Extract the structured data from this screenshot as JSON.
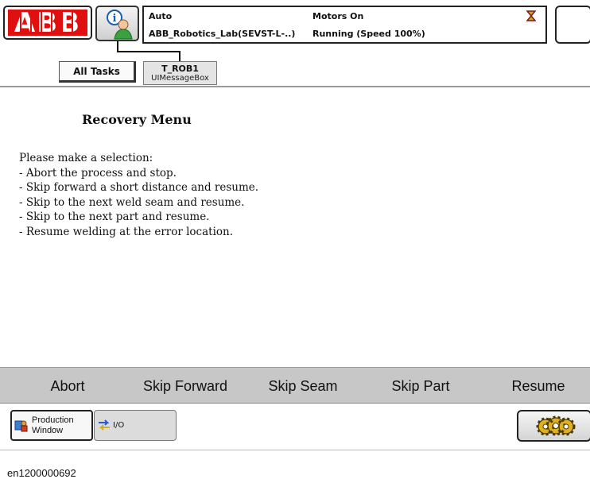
{
  "header": {
    "logo_text": "ABB",
    "mode": "Auto",
    "system_name": "ABB_Robotics_Lab(SEVST-L-..)",
    "motors_state": "Motors On",
    "run_state": "Running (Speed 100%)",
    "icons": [
      "info-user-icon",
      "hourglass-icon"
    ]
  },
  "tabs": {
    "all_tasks": "All Tasks",
    "task_name": "T_ROB1",
    "task_sub": "UIMessageBox"
  },
  "message": {
    "title": "Recovery Menu",
    "lines": [
      "Please make a selection:",
      "- Abort the process and stop.",
      "- Skip forward a short distance and resume.",
      "- Skip to the next weld seam and resume.",
      "- Skip to the next part and resume.",
      "- Resume welding at the error location."
    ]
  },
  "buttons": [
    "Abort",
    "Skip Forward",
    "Skip Seam",
    "Skip Part",
    "Resume"
  ],
  "taskbar": {
    "production_window_line1": "Production",
    "production_window_line2": "Window",
    "io_label": "I/O",
    "icons": [
      "production-window-icon",
      "io-icon",
      "gears-icon"
    ]
  },
  "caption": "en1200000692",
  "colors": {
    "abb_red": "#e01010",
    "button_bar": "#c7c7c7"
  }
}
